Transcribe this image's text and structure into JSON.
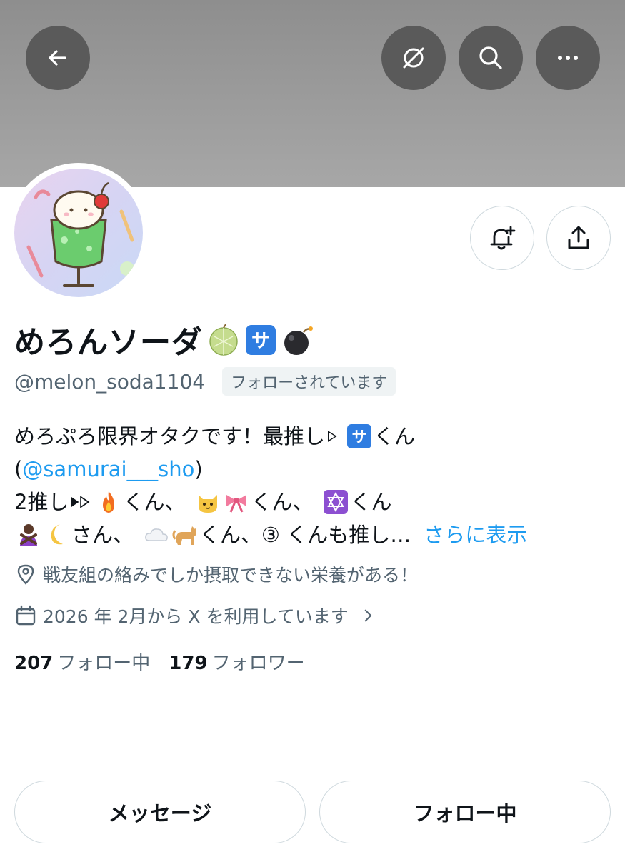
{
  "header": {
    "back_icon": "arrow-left-icon",
    "grok_icon": "grok-icon",
    "search_icon": "search-icon",
    "more_icon": "more-dots-icon"
  },
  "profile": {
    "display_name": "めろんソーダ",
    "name_emojis": [
      "melon",
      "sa-button",
      "bomb"
    ],
    "handle": "@melon_soda1104",
    "follows_you_badge": "フォローされています"
  },
  "bio": {
    "line1_text": "めろぷろ限界オタクです！最推し",
    "line1_suffix": "くん",
    "line2_open": "(",
    "line2_mention": "@samurai___sho",
    "line2_close": " )",
    "line3_prefix": "2推し",
    "line3_kun1": "くん、",
    "line3_kun2": "くん、",
    "line3_kun3": "くん",
    "line4_san": "さん、",
    "line4_kun": "くん、",
    "line4_tail": "③ くんも推し…",
    "show_more": "さらに表示"
  },
  "location": {
    "icon": "location-pin-icon",
    "text": "戦友組の絡みでしか摂取できない栄養がある！"
  },
  "joined": {
    "icon": "calendar-icon",
    "text": "2026 年 2月から X を利用しています"
  },
  "stats": {
    "following_count": "207",
    "following_label": "フォロー中",
    "followers_count": "179",
    "followers_label": "フォロワー"
  },
  "actions": {
    "notify_icon": "bell-plus-icon",
    "share_icon": "share-icon",
    "message_label": "メッセージ",
    "following_label": "フォロー中"
  },
  "colors": {
    "link": "#1d9bf0",
    "secondary_text": "#536471",
    "primary_text": "#0f1419",
    "banner": "#9a9a9a"
  }
}
